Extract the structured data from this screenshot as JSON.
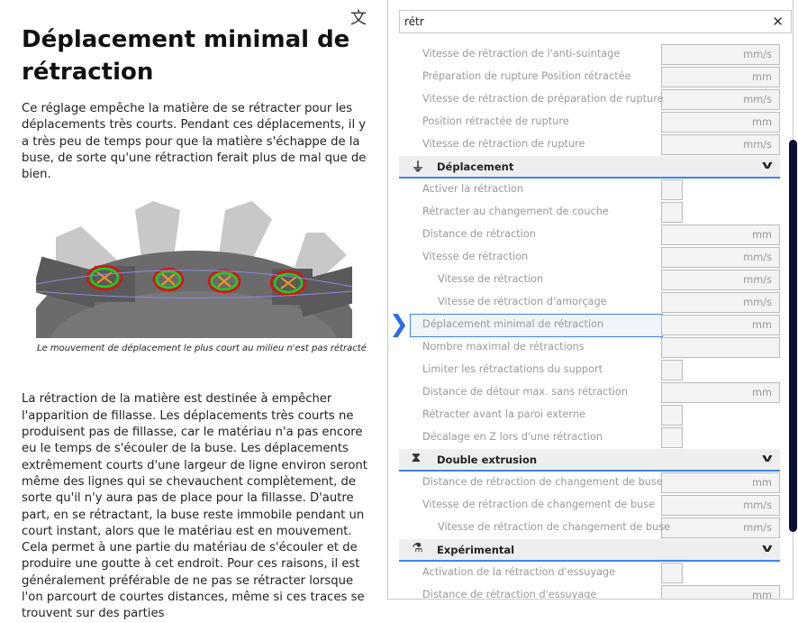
{
  "help": {
    "title": "Déplacement minimal de rétraction",
    "intro": "Ce réglage empêche la matière de se rétracter pour les déplacements très courts. Pendant ces déplacements, il y a très peu de temps pour que la matière s'échappe de la buse, de sorte qu'une rétraction ferait plus de mal que de bien.",
    "caption": "Le mouvement de déplacement le plus court au milieu n'est pas rétracté",
    "body": "La rétraction de la matière est destinée à empêcher l'apparition de fillasse. Les déplacements très courts ne produisent pas de fillasse, car le matériau n'a pas encore eu le temps de s'écouler de la buse. Les déplacements extrêmement courts d'une largeur de ligne environ seront même des lignes qui se chevauchent complètement, de sorte qu'il n'y aura pas de place pour la fillasse. D'autre part, en se rétractant, la buse reste immobile pendant un court instant, alors que le matériau est en mouvement. Cela permet à une partie du matériau de s'écouler et de produire une goutte à cet endroit. Pour ces raisons, il est généralement préférable de ne pas se rétracter lorsque l'on parcourt de courtes distances, même si ces traces se trouvent sur des parties"
  },
  "search": {
    "value": "rétr",
    "clear_icon": "close-icon"
  },
  "rows": [
    {
      "type": "input",
      "label": "Vitesse de rétraction de l'anti-suintage",
      "unit": "mm/s"
    },
    {
      "type": "input",
      "label": "Préparation de rupture Position rétractée",
      "unit": "mm"
    },
    {
      "type": "input",
      "label": "Vitesse de rétraction de préparation de rupture",
      "unit": "mm/s"
    },
    {
      "type": "input",
      "label": "Position rétractée de rupture",
      "unit": "mm"
    },
    {
      "type": "input",
      "label": "Vitesse de rétraction de rupture",
      "unit": "mm/s"
    },
    {
      "type": "cat",
      "label": "Déplacement",
      "icon": "travel-icon"
    },
    {
      "type": "check",
      "label": "Activer la rétraction"
    },
    {
      "type": "check",
      "label": "Rétracter au changement de couche"
    },
    {
      "type": "input",
      "label": "Distance de rétraction",
      "unit": "mm"
    },
    {
      "type": "input",
      "label": "Vitesse de rétraction",
      "unit": "mm/s"
    },
    {
      "type": "input",
      "label": "Vitesse de rétraction",
      "unit": "mm/s",
      "indent": true
    },
    {
      "type": "input",
      "label": "Vitesse de rétraction d'amorçage",
      "unit": "mm/s",
      "indent": true
    },
    {
      "type": "input",
      "label": "Déplacement minimal de rétraction",
      "unit": "mm",
      "selected": true
    },
    {
      "type": "input",
      "label": "Nombre maximal de rétractions",
      "unit": ""
    },
    {
      "type": "check",
      "label": "Limiter les rétractations du support"
    },
    {
      "type": "input",
      "label": "Distance de détour max. sans rétraction",
      "unit": "mm"
    },
    {
      "type": "check",
      "label": "Rétracter avant la paroi externe"
    },
    {
      "type": "check",
      "label": "Décalage en Z lors d'une rétraction"
    },
    {
      "type": "cat",
      "label": "Double extrusion",
      "icon": "dual-extrusion-icon"
    },
    {
      "type": "input",
      "label": "Distance de rétraction de changement de buse",
      "unit": "mm"
    },
    {
      "type": "input",
      "label": "Vitesse de rétraction de changement de buse",
      "unit": "mm/s"
    },
    {
      "type": "input",
      "label": "Vitesse de rétraction de changement de buse",
      "unit": "mm/s",
      "indent": true
    },
    {
      "type": "cat",
      "label": "Expérimental",
      "icon": "experimental-icon"
    },
    {
      "type": "check",
      "label": "Activation de la rétraction d'essuyage"
    },
    {
      "type": "input",
      "label": "Distance de rétraction d'essuyage",
      "unit": "mm"
    }
  ]
}
